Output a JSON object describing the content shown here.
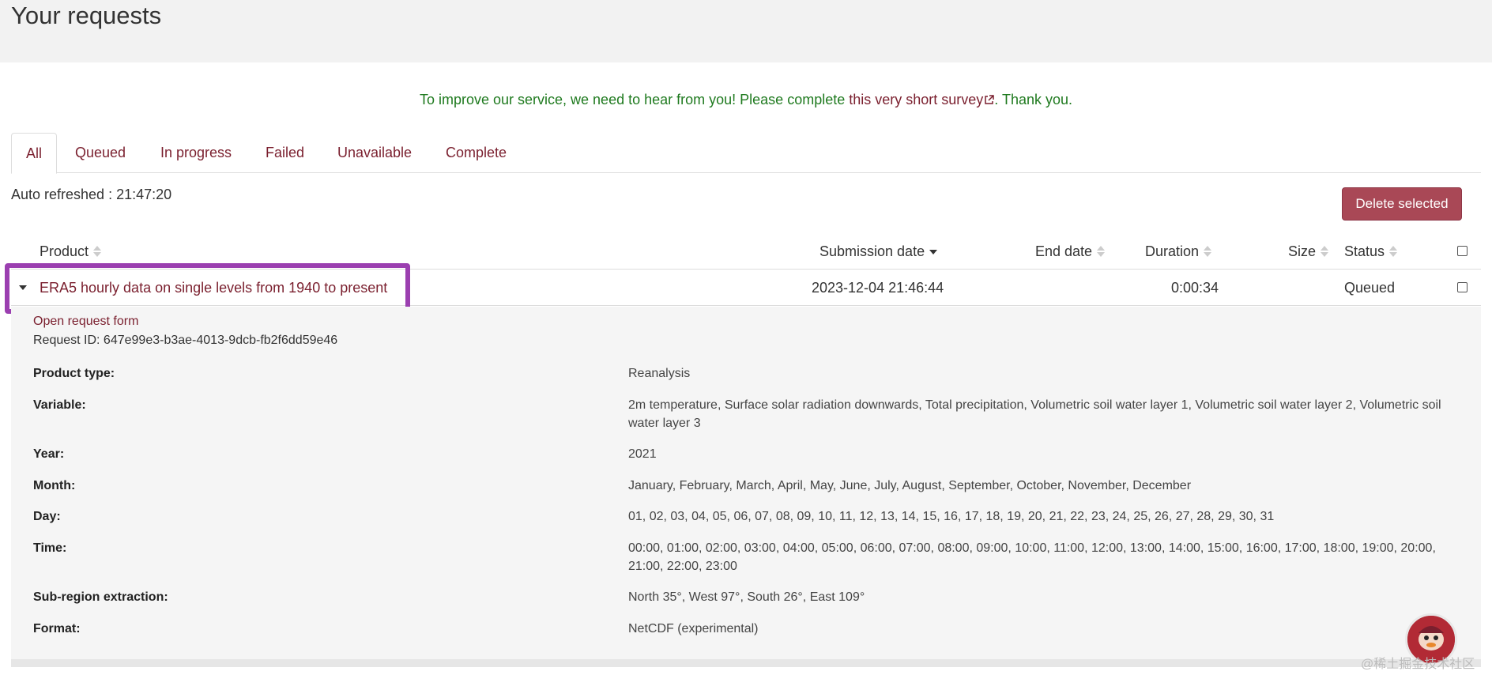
{
  "page": {
    "title": "Your requests"
  },
  "survey": {
    "prefix": "To improve our service, we need to hear from you! Please complete ",
    "link": "this very short survey",
    "suffix": ". Thank you."
  },
  "tabs": [
    "All",
    "Queued",
    "In progress",
    "Failed",
    "Unavailable",
    "Complete"
  ],
  "refresh": {
    "text": "Auto refreshed : 21:47:20"
  },
  "toolbar": {
    "delete_label": "Delete selected"
  },
  "table": {
    "columns": [
      "Product",
      "Submission date",
      "End date",
      "Duration",
      "Size",
      "Status"
    ],
    "rows": [
      {
        "product": "ERA5 hourly data on single levels from 1940 to present",
        "submission_date": "2023-12-04 21:46:44",
        "end_date": "",
        "duration": "0:00:34",
        "size": "",
        "status": "Queued"
      }
    ]
  },
  "details": {
    "open_form": "Open request form",
    "request_id": "Request ID: 647e99e3-b3ae-4013-9dcb-fb2f6dd59e46",
    "fields": [
      {
        "label": "Product type:",
        "value": "Reanalysis"
      },
      {
        "label": "Variable:",
        "value": "2m temperature, Surface solar radiation downwards, Total precipitation, Volumetric soil water layer 1, Volumetric soil water layer 2, Volumetric soil water layer 3"
      },
      {
        "label": "Year:",
        "value": "2021"
      },
      {
        "label": "Month:",
        "value": "January, February, March, April, May, June, July, August, September, October, November, December"
      },
      {
        "label": "Day:",
        "value": "01, 02, 03, 04, 05, 06, 07, 08, 09, 10, 11, 12, 13, 14, 15, 16, 17, 18, 19, 20, 21, 22, 23, 24, 25, 26, 27, 28, 29, 30, 31"
      },
      {
        "label": "Time:",
        "value": "00:00, 01:00, 02:00, 03:00, 04:00, 05:00, 06:00, 07:00, 08:00, 09:00, 10:00, 11:00, 12:00, 13:00, 14:00, 15:00, 16:00, 17:00, 18:00, 19:00, 20:00, 21:00, 22:00, 23:00"
      },
      {
        "label": "Sub-region extraction:",
        "value": "North 35°, West 97°, South 26°, East 109°"
      },
      {
        "label": "Format:",
        "value": "NetCDF (experimental)"
      }
    ]
  },
  "watermark": "@稀土掘金技术社区",
  "colors": {
    "link": "#7a1f2e",
    "survey": "#1f7a1f",
    "button": "#a94856",
    "highlight": "#9b3fb0"
  }
}
